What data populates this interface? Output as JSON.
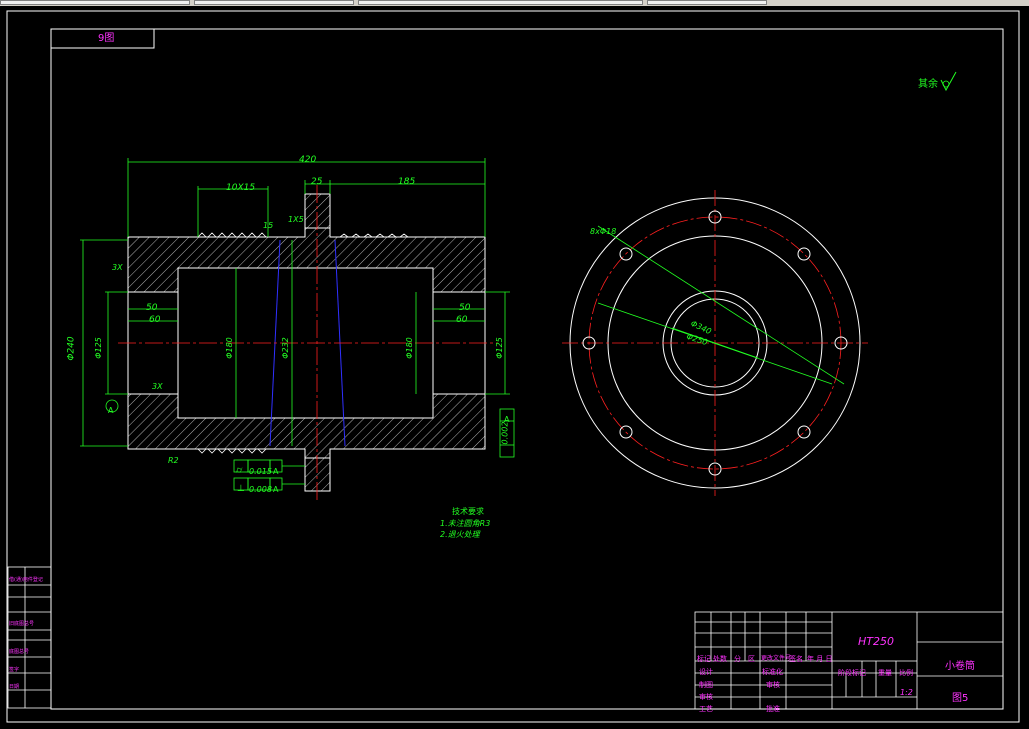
{
  "app": {
    "window": "CAD drawing viewport"
  },
  "colors": {
    "background": "#000000",
    "frame": "#ffffff",
    "dimension": "#22ff22",
    "centerline": "#ff2020",
    "text_magenta": "#ff33ff",
    "hidden": "#3030ff"
  },
  "drawing": {
    "top_label": "9图",
    "surface_note": "其余",
    "dims": {
      "overall_length": "420",
      "groove": "10X15",
      "flange_w": "25",
      "right_len": "185",
      "d_left_50": "50",
      "d_left_60": "60",
      "d_right_50": "50",
      "d_right_60": "60",
      "dia_outer": "Φ240",
      "dia_bore": "Φ180",
      "dia_bore_right": "Φ180",
      "dia_cone": "Φ232",
      "dia_left_journal": "Φ125",
      "dia_right_journal": "Φ125",
      "chamfer1": "3X",
      "chamfer2": "3X",
      "chamfer_top": "1X5",
      "chamfer_small": "15",
      "radius": "R2",
      "datum": "A",
      "circle_holes": "8xΦ18",
      "pcd": "Φ340",
      "pcd_inner": "Φ250"
    },
    "tolerances": {
      "runout": {
        "value": "0.015",
        "datum": "A"
      },
      "perp": {
        "value": "0.008",
        "datum": "A"
      },
      "right_runout": {
        "value": "0.002",
        "datum": "A"
      }
    },
    "tech_notes": {
      "title": "技术要求",
      "line1": "1.未注圆角R3",
      "line2": "2.退火处理"
    }
  },
  "title_block": {
    "material": "HT250",
    "part_name": "小卷筒",
    "drawing_no": "图5",
    "scale": "1:2",
    "headers": {
      "mark": "标记",
      "count": "处数",
      "zone": "分",
      "area": "区",
      "change_doc": "更改文件号",
      "sign": "签名",
      "date": "年 月 日"
    },
    "roles": {
      "design": "设计",
      "standardize": "标准化",
      "draw": "制图",
      "review": "审核",
      "process": "工艺",
      "approve": "批准",
      "stage_mark": "阶段标记",
      "weight": "重量",
      "ratio": "比例"
    }
  },
  "left_strip": {
    "items": [
      "借(通)用件登记",
      "旧底图总号",
      "底图总号",
      "签字",
      "日期"
    ]
  }
}
